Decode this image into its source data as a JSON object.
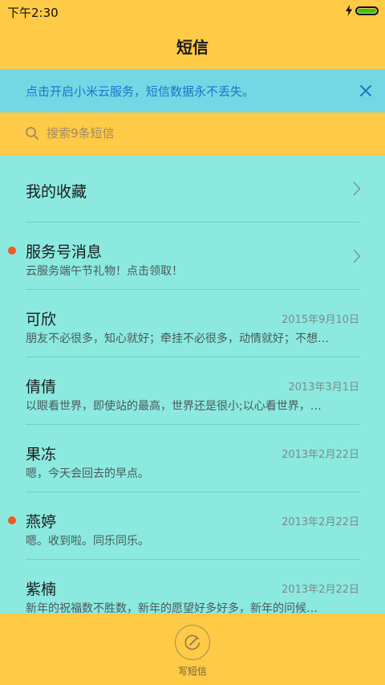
{
  "status_bar": {
    "time": "下午2:30"
  },
  "header": {
    "title": "短信"
  },
  "banner": {
    "text": "点击开启小米云服务，短信数据永不丢失。"
  },
  "search": {
    "placeholder": "搜索9条短信"
  },
  "favorites": {
    "label": "我的收藏"
  },
  "conversations": [
    {
      "name": "服务号消息",
      "preview": "云服务端午节礼物！点击领取！",
      "date": "",
      "unread": true
    },
    {
      "name": "可欣",
      "preview": "朋友不必很多，知心就好；牵挂不必很多，动情就好；不想…",
      "date": "2015年9月10日",
      "unread": false
    },
    {
      "name": "倩倩",
      "preview": "以眼看世界，即使站的最高，世界还是很小;以心看世界，…",
      "date": "2013年3月1日",
      "unread": false
    },
    {
      "name": "果冻",
      "preview": "嗯，今天会回去的早点。",
      "date": "2013年2月22日",
      "unread": false
    },
    {
      "name": "燕婷",
      "preview": "嗯。收到啦。同乐同乐。",
      "date": "2013年2月22日",
      "unread": true
    },
    {
      "name": "紫楠",
      "preview": "新年的祝福数不胜数，新年的愿望好多好多，新年的问候…",
      "date": "2013年2月22日",
      "unread": false
    }
  ],
  "bottom_bar": {
    "compose_label": "写短信"
  },
  "colors": {
    "accent_yellow": "#ffca45",
    "list_background": "#8be9e0",
    "banner_background": "#74d8e4",
    "banner_text": "#1d74c9",
    "unread_dot": "#f05a22"
  },
  "icons": {
    "charge": "lightning-icon",
    "battery": "battery-icon",
    "close": "close-icon",
    "search": "search-icon",
    "chevron": "chevron-right-icon",
    "compose": "compose-icon"
  }
}
